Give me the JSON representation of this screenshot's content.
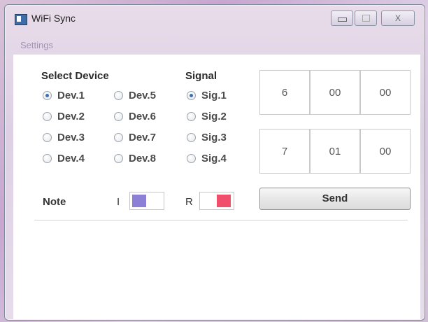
{
  "window": {
    "title": "WiFi Sync",
    "close_glyph": "X"
  },
  "menu": {
    "items": [
      "Settings"
    ]
  },
  "device_group": {
    "heading": "Select Device",
    "options": [
      "Dev.1",
      "Dev.2",
      "Dev.3",
      "Dev.4",
      "Dev.5",
      "Dev.6",
      "Dev.7",
      "Dev.8"
    ],
    "selected": "Dev.1"
  },
  "signal_group": {
    "heading": "Signal",
    "options": [
      "Sig.1",
      "Sig.2",
      "Sig.3",
      "Sig.4"
    ],
    "selected": "Sig.1"
  },
  "time_rows": [
    [
      "6",
      "00",
      "00"
    ],
    [
      "7",
      "01",
      "00"
    ]
  ],
  "note": {
    "label": "Note",
    "i_label": "I",
    "r_label": "R",
    "i_color": "#8b7fd6",
    "r_color": "#f04e6a"
  },
  "send_label": "Send"
}
